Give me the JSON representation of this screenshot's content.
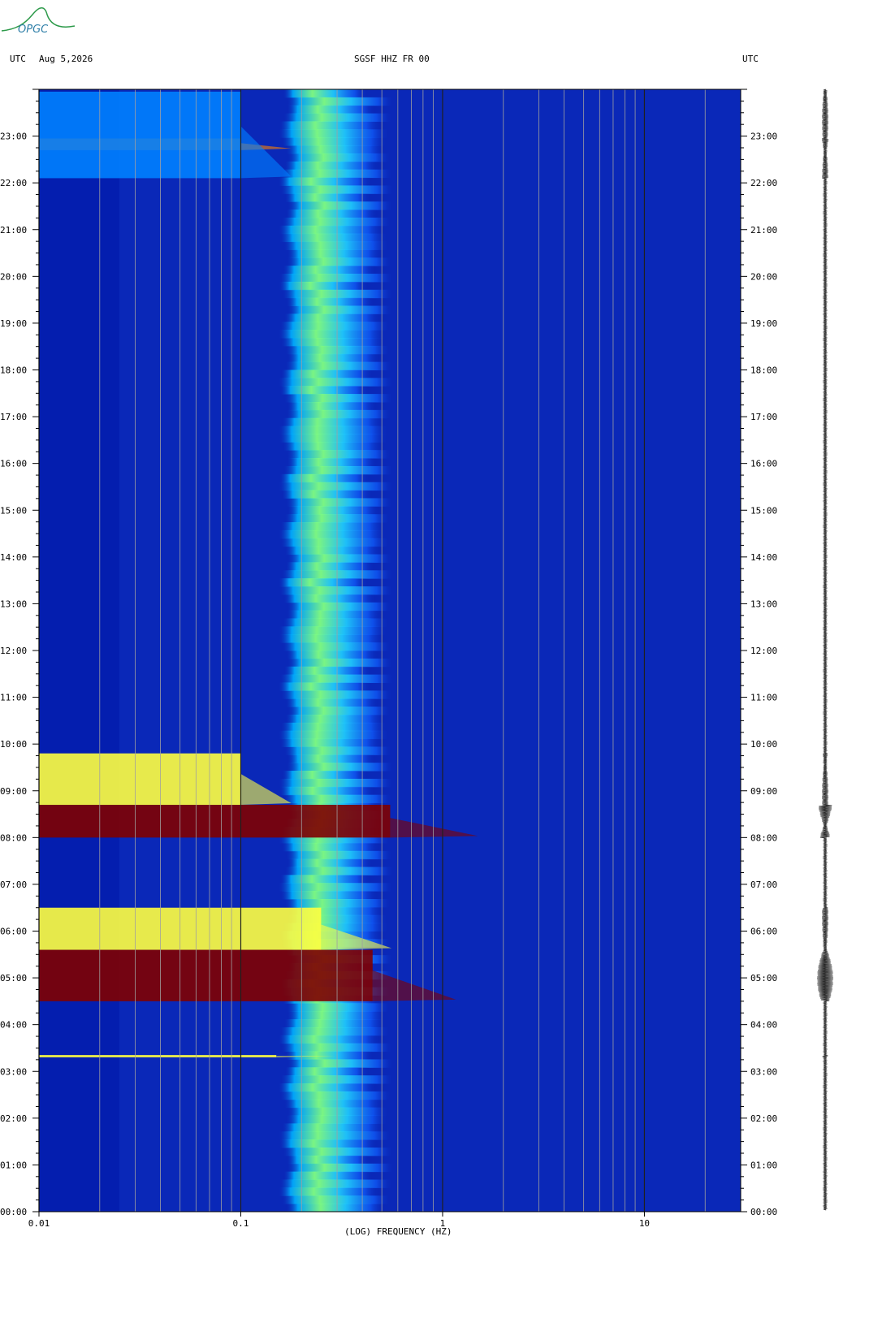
{
  "header": {
    "left_tz": "UTC",
    "date": "Aug 5,2026",
    "station": "SGSF HHZ FR 00",
    "right_tz": "UTC"
  },
  "logo": {
    "text": "OPGC",
    "color": "#2f7fa8"
  },
  "chart_data": {
    "type": "heatmap",
    "title": "SGSF HHZ FR 00",
    "xlabel": "(LOG) FREQUENCY (HZ)",
    "x_scale": "log",
    "xlim": [
      0.01,
      30
    ],
    "x_ticks": [
      {
        "value": 0.01,
        "label": "0.01"
      },
      {
        "value": 0.1,
        "label": "0.1"
      },
      {
        "value": 1,
        "label": "1"
      },
      {
        "value": 10,
        "label": "10"
      }
    ],
    "ylim_hours": [
      0,
      24
    ],
    "y_tick_labels": [
      "00:00",
      "01:00",
      "02:00",
      "03:00",
      "04:00",
      "05:00",
      "06:00",
      "07:00",
      "08:00",
      "09:00",
      "10:00",
      "11:00",
      "12:00",
      "13:00",
      "14:00",
      "15:00",
      "16:00",
      "17:00",
      "18:00",
      "19:00",
      "20:00",
      "21:00",
      "22:00",
      "23:00"
    ],
    "colormap": [
      "#00009a",
      "#0030ff",
      "#00c8ff",
      "#40ffb0",
      "#ffff40",
      "#ff8000",
      "#c00000",
      "#800000"
    ],
    "background_color": "#0a28b8",
    "band": {
      "freq_start": 0.17,
      "freq_peak": 0.22,
      "freq_end": 0.5,
      "color": "#60ffc0"
    },
    "events": [
      {
        "start_hour": 4.5,
        "end_hour": 5.6,
        "max_freq": 0.45,
        "peak_color": "#800000"
      },
      {
        "start_hour": 5.6,
        "end_hour": 6.5,
        "max_freq": 0.25,
        "peak_color": "#ffff40"
      },
      {
        "start_hour": 8.0,
        "end_hour": 8.7,
        "max_freq": 0.55,
        "peak_color": "#800000"
      },
      {
        "start_hour": 8.7,
        "end_hour": 9.8,
        "max_freq": 0.1,
        "peak_color": "#ffff40"
      },
      {
        "start_hour": 3.3,
        "end_hour": 3.35,
        "max_freq": 0.15,
        "peak_color": "#ffff40"
      },
      {
        "start_hour": 22.7,
        "end_hour": 22.95,
        "max_freq": 0.1,
        "peak_color": "#ff8000"
      },
      {
        "start_hour": 22.1,
        "end_hour": 23.95,
        "max_freq": 0.1,
        "peak_color": "#0080ff"
      }
    ],
    "seismogram_color": "#000000"
  }
}
